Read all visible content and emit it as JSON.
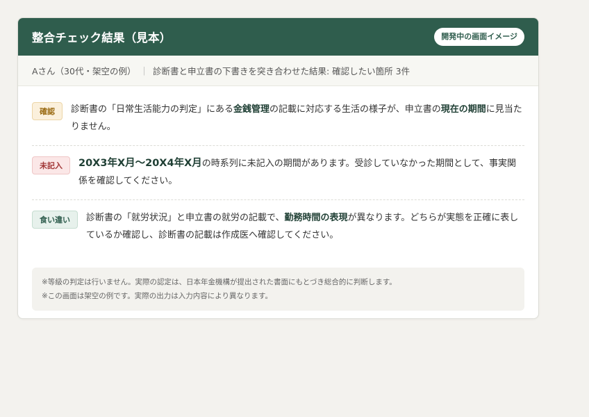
{
  "card": {
    "title": "整合チェック結果（見本）",
    "badge": "開発中の画面イメージ",
    "summary_person": "Aさん（30代・架空の例）",
    "summary_separator": "｜",
    "summary_detail": "診断書と申立書の下書きを突き合わせた結果: 確認したい箇所 3件"
  },
  "findings": [
    {
      "tag": "確認",
      "p1": "診断書の「日常生活能力の判定」にある",
      "b1": "金銭管理",
      "p2": "の記載に対応する生活の様子が、申立書の",
      "b2": "現在の期間",
      "p3": "に見当たりません。"
    },
    {
      "tag": "未記入",
      "b1": "20X3年X月〜20X4年X月",
      "p1": "の時系列に未記入の期間があります。受診していなかった期間として、事実関係を確認してください。"
    },
    {
      "tag": "食い違い",
      "p1": "診断書の「就労状況」と申立書の就労の記載で、",
      "b1": "勤務時間の表現",
      "p2": "が異なります。どちらが実態を正確に表しているか確認し、診断書の記載は作成医へ確認してください。"
    }
  ],
  "notes": [
    "※等級の判定は行いません。実際の認定は、日本年金機構が提出された書面にもとづき総合的に判断します。",
    "※この画面は架空の例です。実際の出力は入力内容により異なります。"
  ],
  "colors": {
    "header_bg": "#2f5d4d",
    "page_bg": "#f3f2ee",
    "tag_confirm": "#9a6a12",
    "tag_missing": "#a23838",
    "tag_diff": "#2f5d4d"
  }
}
